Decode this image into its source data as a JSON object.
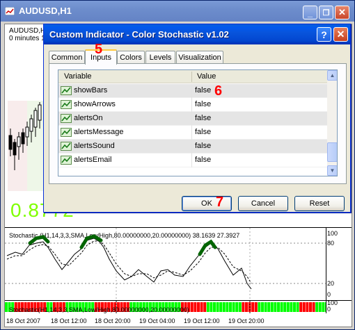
{
  "chart_window": {
    "title": "AUDUSD,H1",
    "minimize": "_",
    "restore": "❐",
    "close": "✕",
    "symbol_line": "AUDUSD,H1",
    "info_line": "0 minutes 1",
    "bid_text": "0.87",
    "bid_text_tail": "72",
    "stochastic_label": "Stochastic (H1,14,3,3,SMA,Low/High,80.00000000,20.00000000) 38.1639 27.3927",
    "stoch_bars_label": "Stochastic(H1,14,3,3,SMA,Low/High,80.00000000,20.00000000)",
    "stoch_axis": [
      "100",
      "80",
      "20",
      "0"
    ],
    "bars_axis": [
      "100",
      "0"
    ],
    "time_labels": [
      "18 Oct 2007",
      "18 Oct 12:00",
      "18 Oct 20:00",
      "19 Oct 04:00",
      "19 Oct 12:00",
      "19 Oct 20:00"
    ],
    "colors": {
      "bid": "#7fff00",
      "bar_green": "#00ff00",
      "bar_red": "#ff0000",
      "arrow_green": "#006400"
    }
  },
  "dialog": {
    "title": "Custom Indicator - Color Stochastic v1.02",
    "help_button": "?",
    "close_button": "✕",
    "tabs": [
      {
        "label": "Common",
        "active": false
      },
      {
        "label": "Inputs",
        "active": true
      },
      {
        "label": "Colors",
        "active": false
      },
      {
        "label": "Levels",
        "active": false
      },
      {
        "label": "Visualization",
        "active": false
      }
    ],
    "grid": {
      "headers": {
        "variable": "Variable",
        "value": "Value"
      },
      "rows": [
        {
          "icon": "parameter-icon",
          "variable": "showBars",
          "value": "false"
        },
        {
          "icon": "parameter-icon",
          "variable": "showArrows",
          "value": "false"
        },
        {
          "icon": "parameter-icon",
          "variable": "alertsOn",
          "value": "false"
        },
        {
          "icon": "parameter-icon",
          "variable": "alertsMessage",
          "value": "false"
        },
        {
          "icon": "parameter-icon",
          "variable": "alertsSound",
          "value": "false"
        },
        {
          "icon": "parameter-icon",
          "variable": "alertsEmail",
          "value": "false"
        }
      ],
      "scroll_position": 0.85
    },
    "buttons": {
      "ok": "OK",
      "cancel": "Cancel",
      "reset": "Reset"
    }
  },
  "annotations": {
    "tab_marker": "5",
    "row_marker": "6",
    "ok_marker": "7",
    "color": "#ff0000"
  }
}
